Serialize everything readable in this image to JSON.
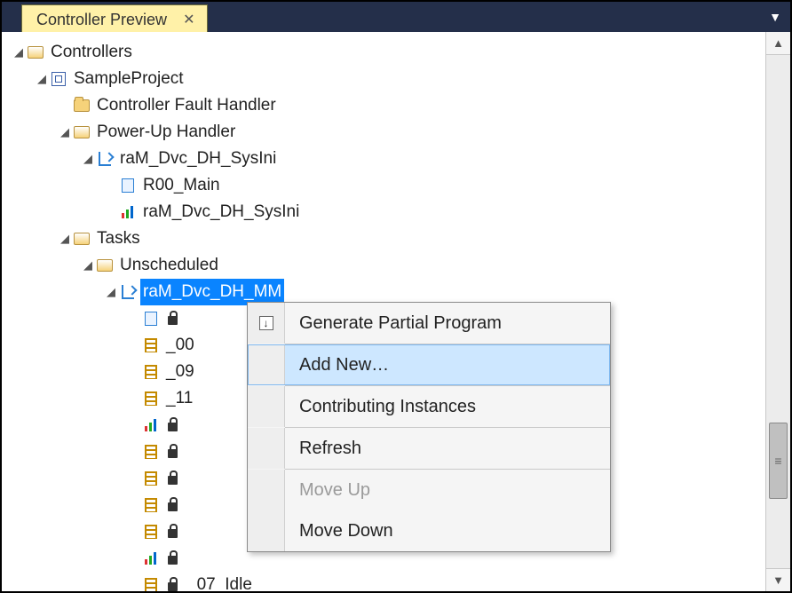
{
  "tab": {
    "title": "Controller Preview"
  },
  "tree": {
    "root": "Controllers",
    "project": "SampleProject",
    "fault_handler": "Controller Fault Handler",
    "power_up": "Power-Up Handler",
    "pu_prog": "raM_Dvc_DH_SysIni",
    "pu_r00": "R00_Main",
    "pu_r_sysini": "raM_Dvc_DH_SysIni",
    "tasks": "Tasks",
    "unscheduled": "Unscheduled",
    "mm_prog": "raM_Dvc_DH_MM",
    "mm_items": [
      {
        "name": "_00",
        "icon": "ladder",
        "locked": false
      },
      {
        "name": "_09",
        "icon": "ladder",
        "locked": false
      },
      {
        "name": "_11",
        "icon": "ladder",
        "locked": false
      },
      {
        "name": "",
        "icon": "chart",
        "locked": true
      },
      {
        "name": "",
        "icon": "ladder",
        "locked": true
      },
      {
        "name": "",
        "icon": "ladder",
        "locked": true
      },
      {
        "name": "",
        "icon": "ladder",
        "locked": true
      },
      {
        "name": "",
        "icon": "ladder",
        "locked": true
      },
      {
        "name": "",
        "icon": "chart",
        "locked": true
      }
    ],
    "mm_last": "_07_Idle",
    "mm_r0_lock": true
  },
  "context_menu": {
    "generate": "Generate Partial Program",
    "add_new": "Add New…",
    "contributing": "Contributing Instances",
    "refresh": "Refresh",
    "move_up": "Move Up",
    "move_down": "Move Down"
  }
}
